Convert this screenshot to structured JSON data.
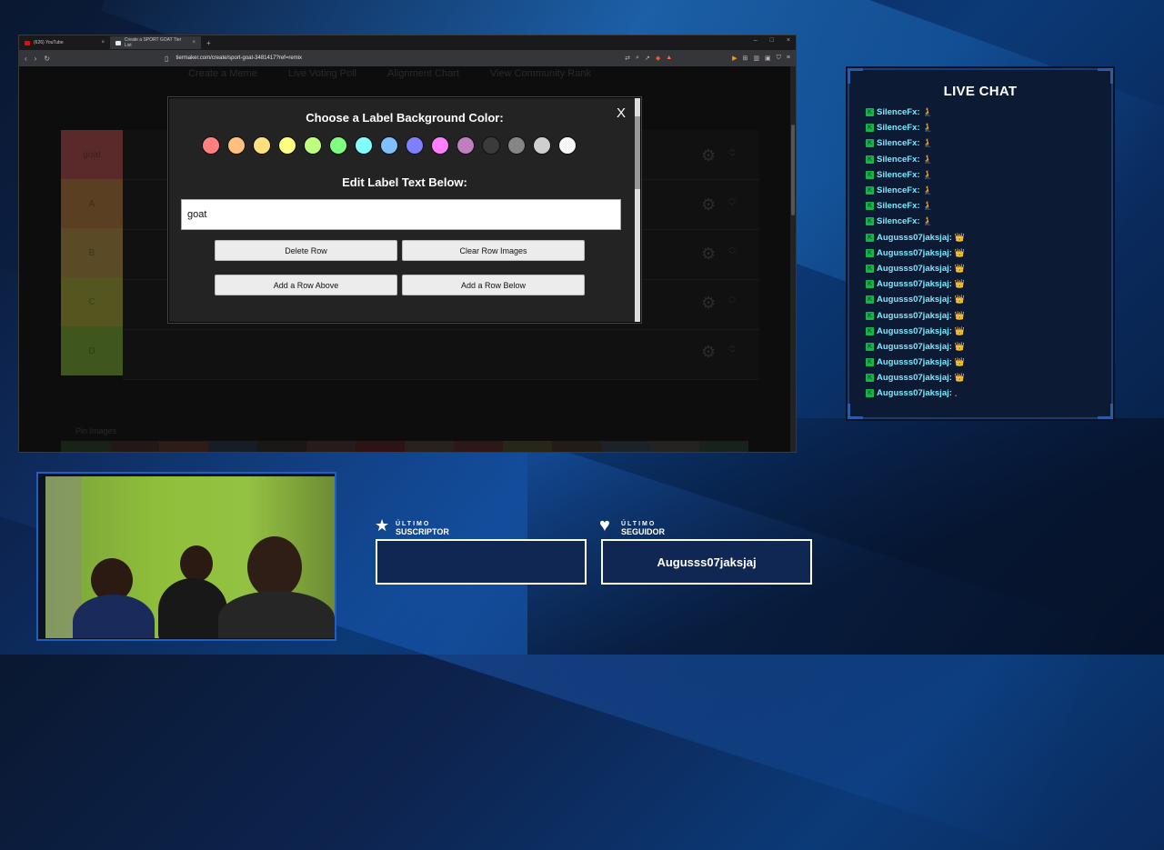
{
  "browser": {
    "tabs": [
      {
        "label": "(626) YouTube",
        "favicon_color": "#ff0000"
      },
      {
        "label": "Create a SPORT GOAT Tier List",
        "favicon_color": "#e8e8e8"
      }
    ],
    "url": "tiermaker.com/create/sport-goat-3481417?ref=remix",
    "page_nav": [
      "Create a Meme",
      "Live Voting Poll",
      "Alignment Chart",
      "View Community Rank"
    ],
    "tiers": [
      {
        "label": "goat",
        "color": "#ff7f7f"
      },
      {
        "label": "A",
        "color": "#ffbf7f"
      },
      {
        "label": "B",
        "color": "#ffdf7f"
      },
      {
        "label": "C",
        "color": "#ffff7f"
      },
      {
        "label": "D",
        "color": "#bfff7f"
      }
    ],
    "pin_images": "Pin Images"
  },
  "modal": {
    "color_heading": "Choose a Label Background Color:",
    "text_heading": "Edit Label Text Below:",
    "label_value": "goat",
    "close": "X",
    "colors": [
      "#ff7f7f",
      "#ffbf7f",
      "#ffdf7f",
      "#ffff7f",
      "#bfff7f",
      "#7fff7f",
      "#7fffff",
      "#7fbfff",
      "#7f7fff",
      "#ff7fff",
      "#bf7fbf",
      "#3b3b3b",
      "#858585",
      "#cfcfcf",
      "#f7f7f7"
    ],
    "delete_row": "Delete Row",
    "clear_row": "Clear Row Images",
    "add_above": "Add a Row Above",
    "add_below": "Add a Row Below"
  },
  "chat": {
    "title": "LIVE CHAT",
    "messages": [
      {
        "user": "SilenceFx:",
        "emoji": "🧎"
      },
      {
        "user": "SilenceFx:",
        "emoji": "🧎"
      },
      {
        "user": "SilenceFx:",
        "emoji": "🧎"
      },
      {
        "user": "SilenceFx:",
        "emoji": "🧎"
      },
      {
        "user": "SilenceFx:",
        "emoji": "🧎"
      },
      {
        "user": "SilenceFx:",
        "emoji": "🧎"
      },
      {
        "user": "SilenceFx:",
        "emoji": "🧎"
      },
      {
        "user": "SilenceFx:",
        "emoji": "🧎"
      },
      {
        "user": "Augusss07jaksjaj:",
        "emoji": "👑"
      },
      {
        "user": "Augusss07jaksjaj:",
        "emoji": "👑"
      },
      {
        "user": "Augusss07jaksjaj:",
        "emoji": "👑"
      },
      {
        "user": "Augusss07jaksjaj:",
        "emoji": "👑"
      },
      {
        "user": "Augusss07jaksjaj:",
        "emoji": "👑"
      },
      {
        "user": "Augusss07jaksjaj:",
        "emoji": "👑"
      },
      {
        "user": "Augusss07jaksjaj:",
        "emoji": "👑"
      },
      {
        "user": "Augusss07jaksjaj:",
        "emoji": "👑"
      },
      {
        "user": "Augusss07jaksjaj:",
        "emoji": "👑"
      },
      {
        "user": "Augusss07jaksjaj:",
        "emoji": "👑"
      },
      {
        "user": "Augusss07jaksjaj:",
        "emoji": "."
      }
    ]
  },
  "widgets": {
    "subscriber": {
      "top": "ÚLTIMO",
      "bottom": "SUSCRIPTOR",
      "value": ""
    },
    "follower": {
      "top": "ÚLTIMO",
      "bottom": "SEGUIDOR",
      "value": "Augusss07jaksjaj"
    }
  }
}
